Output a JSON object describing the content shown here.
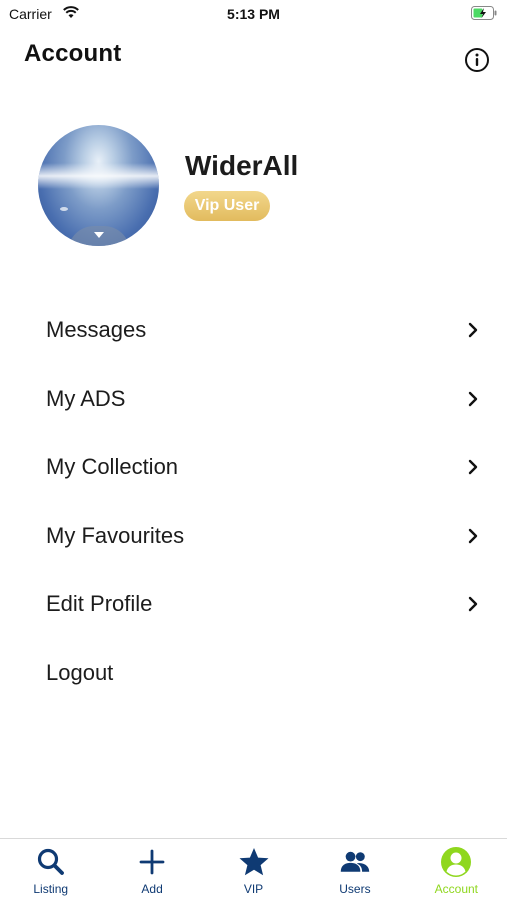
{
  "status_bar": {
    "carrier": "Carrier",
    "time": "5:13 PM"
  },
  "header": {
    "title": "Account",
    "info_icon": "info-circle-icon"
  },
  "profile": {
    "name": "WiderAll",
    "badge": "Vip User"
  },
  "menu": [
    {
      "label": "Messages",
      "has_chevron": true
    },
    {
      "label": "My ADS",
      "has_chevron": true
    },
    {
      "label": "My Collection",
      "has_chevron": true
    },
    {
      "label": "My Favourites",
      "has_chevron": true
    },
    {
      "label": "Edit Profile",
      "has_chevron": true
    },
    {
      "label": "Logout",
      "has_chevron": false
    }
  ],
  "tab_bar": {
    "tabs": [
      {
        "label": "Listing",
        "icon": "search-icon",
        "active": false
      },
      {
        "label": "Add",
        "icon": "plus-icon",
        "active": false
      },
      {
        "label": "VIP",
        "icon": "star-icon",
        "active": false
      },
      {
        "label": "Users",
        "icon": "users-icon",
        "active": false
      },
      {
        "label": "Account",
        "icon": "user-circle-icon",
        "active": true
      }
    ]
  },
  "colors": {
    "brand_navy": "#0f3a73",
    "active_green": "#8fd71e",
    "badge_gold": "#e2bb5e"
  }
}
